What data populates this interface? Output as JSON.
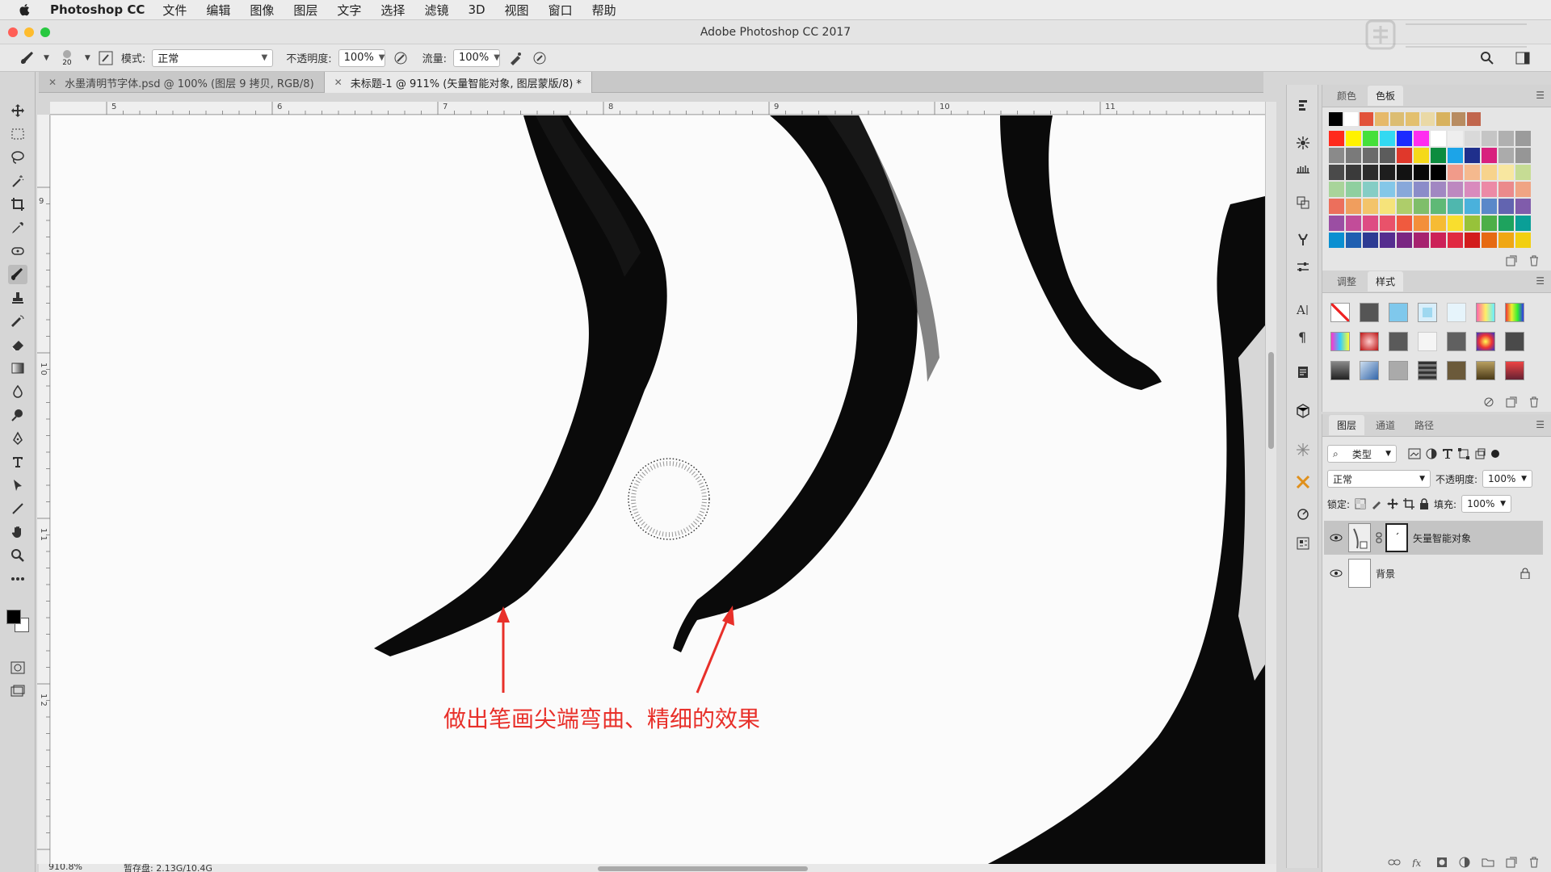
{
  "menubar": {
    "app": "Photoshop CC",
    "items": [
      "文件",
      "编辑",
      "图像",
      "图层",
      "文字",
      "选择",
      "滤镜",
      "3D",
      "视图",
      "窗口",
      "帮助"
    ]
  },
  "window": {
    "title": "Adobe Photoshop CC 2017"
  },
  "options": {
    "brush_size": "20",
    "mode_label": "模式:",
    "mode_value": "正常",
    "opacity_label": "不透明度:",
    "opacity_value": "100%",
    "flow_label": "流量:",
    "flow_value": "100%"
  },
  "tabs": [
    {
      "label": "水墨清明节字体.psd @ 100% (图层 9 拷贝, RGB/8)",
      "active": false
    },
    {
      "label": "未标题-1 @ 911% (矢量智能对象, 图层蒙版/8) *",
      "active": true
    }
  ],
  "ruler": {
    "top": [
      "5",
      "6",
      "7",
      "8",
      "9",
      "10",
      "11"
    ],
    "left": [
      "9",
      "1 0",
      "1 1",
      "1 2"
    ]
  },
  "canvas": {
    "annotation": "做出笔画尖端弯曲、精细的效果"
  },
  "status": {
    "zoom": "910.8%",
    "doc": "暂存盘: 2.13G/10.4G"
  },
  "panels": {
    "swatches": {
      "tabs": [
        "颜色",
        "色板"
      ],
      "active": "色板",
      "recent": [
        "#000000",
        "#ffffff",
        "#e2523a",
        "#e6b96a",
        "#dcbd72",
        "#e3c06e",
        "#ead9a6",
        "#d8b25e",
        "#b88c61",
        "#c1664d"
      ],
      "grid": [
        "#ff2a1c",
        "#fff200",
        "#45e03a",
        "#33d9f2",
        "#1b2bff",
        "#ff2cf0",
        "#ffffff",
        "#eeeeee",
        "#d9d9d9",
        "#c5c5c5",
        "#b0b0b0",
        "#9b9b9b",
        "#8a8a8a",
        "#7a7a7a",
        "#6b6b6b",
        "#5c5c5c",
        "#e0382b",
        "#f5d91a",
        "#0c8c3f",
        "#1ca4e8",
        "#1f2f8c",
        "#d8207e",
        "#ababab",
        "#969696",
        "#4a4a4a",
        "#3a3a3a",
        "#2c2c2c",
        "#1e1e1e",
        "#121212",
        "#080808",
        "#000000",
        "#f19b8a",
        "#f5b98e",
        "#f7d38c",
        "#f8e7a0",
        "#c6dc94",
        "#a8d49a",
        "#8fcf9f",
        "#85cdc5",
        "#84c7e8",
        "#88a8da",
        "#8b8cc9",
        "#a187c2",
        "#bd88c0",
        "#d98abd",
        "#ec8aa6",
        "#eb8a8c",
        "#f0a484",
        "#ec6f5c",
        "#f09e5e",
        "#f3c46a",
        "#f6e37a",
        "#aecd6a",
        "#7fbe6a",
        "#5fb976",
        "#4fb7ae",
        "#4ab1dc",
        "#5a88c9",
        "#6264b0",
        "#805cab",
        "#9b4ea3",
        "#c24c99",
        "#de4c83",
        "#e9526a",
        "#f05a3e",
        "#f38f3a",
        "#f6bb34",
        "#f9de2e",
        "#97c23a",
        "#4daf48",
        "#1ea35e",
        "#0a9f97",
        "#0a8fd1",
        "#1f5fb1",
        "#2d3b93",
        "#552d8f",
        "#7a2682",
        "#a6236f",
        "#cc2158",
        "#e02941",
        "#d21c1c",
        "#e66a12",
        "#f0a713",
        "#f2cf10"
      ]
    },
    "styles": {
      "tabs": [
        "调整",
        "样式"
      ],
      "active": "样式"
    },
    "layers": {
      "tabs": [
        "图层",
        "通道",
        "路径"
      ],
      "active": "图层",
      "kind_filter": "类型",
      "blend_mode": "正常",
      "opacity_label": "不透明度:",
      "opacity_value": "100%",
      "lock_label": "锁定:",
      "fill_label": "填充:",
      "fill_value": "100%",
      "items": [
        {
          "name": "矢量智能对象",
          "selected": true
        },
        {
          "name": "背景",
          "selected": false,
          "locked": true
        }
      ]
    }
  }
}
